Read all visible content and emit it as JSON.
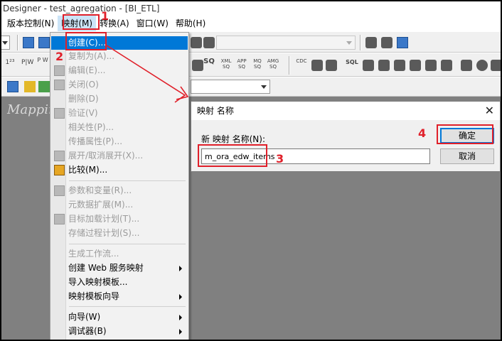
{
  "window": {
    "title": "Designer - test_agregation - [BI_ETL]"
  },
  "menubar": [
    {
      "label": "版本控制(N)"
    },
    {
      "label": "映射(M)"
    },
    {
      "label": "转换(A)"
    },
    {
      "label": "窗口(W)"
    },
    {
      "label": "帮助(H)"
    }
  ],
  "toolbar": {
    "row2_labels": [
      "SQ",
      "XML SQ",
      "APP SQ",
      "MQ SQ",
      "AMG SQ",
      "CDC",
      "SQL"
    ]
  },
  "workspace": {
    "title": "Mappin"
  },
  "menu": {
    "items": [
      {
        "label": "创建(C)...",
        "enabled": true,
        "highlighted": true,
        "submenu": false
      },
      {
        "label": "复制为(A)...",
        "enabled": false,
        "submenu": false
      },
      {
        "label": "编辑(E)...",
        "enabled": false,
        "submenu": false
      },
      {
        "label": "关闭(O)",
        "enabled": false,
        "submenu": false
      },
      {
        "label": "删除(D)",
        "enabled": false,
        "submenu": false
      },
      {
        "label": "验证(V)",
        "enabled": false,
        "submenu": false
      },
      {
        "label": "相关性(P)...",
        "enabled": false,
        "submenu": false
      },
      {
        "label": "传播属性(P)...",
        "enabled": false,
        "submenu": false
      },
      {
        "label": "展开/取消展开(X)...",
        "enabled": false,
        "submenu": false
      },
      {
        "label": "比较(M)...",
        "enabled": true,
        "submenu": false
      },
      {
        "label": "参数和变量(R)...",
        "enabled": false,
        "submenu": false
      },
      {
        "label": "元数据扩展(M)...",
        "enabled": false,
        "submenu": false
      },
      {
        "label": "目标加载计划(T)...",
        "enabled": false,
        "submenu": false
      },
      {
        "label": "存储过程计划(S)...",
        "enabled": false,
        "submenu": false
      },
      {
        "label": "生成工作流...",
        "enabled": false,
        "submenu": false
      },
      {
        "label": "创建 Web 服务映射",
        "enabled": true,
        "submenu": true
      },
      {
        "label": "导入映射模板...",
        "enabled": true,
        "submenu": false
      },
      {
        "label": "映射模板向导",
        "enabled": true,
        "submenu": true
      },
      {
        "label": "向导(W)",
        "enabled": true,
        "submenu": true
      },
      {
        "label": "调试器(B)",
        "enabled": true,
        "submenu": true
      }
    ]
  },
  "dialog": {
    "title": "映射 名称",
    "close_glyph": "✕",
    "field_label": "新 映射 名称(N):",
    "field_value": "m_ora_edw_items",
    "ok_label": "确定",
    "cancel_label": "取消"
  },
  "annotations": {
    "color": "#e0202a",
    "steps": [
      "1",
      "2",
      "3",
      "4"
    ]
  }
}
